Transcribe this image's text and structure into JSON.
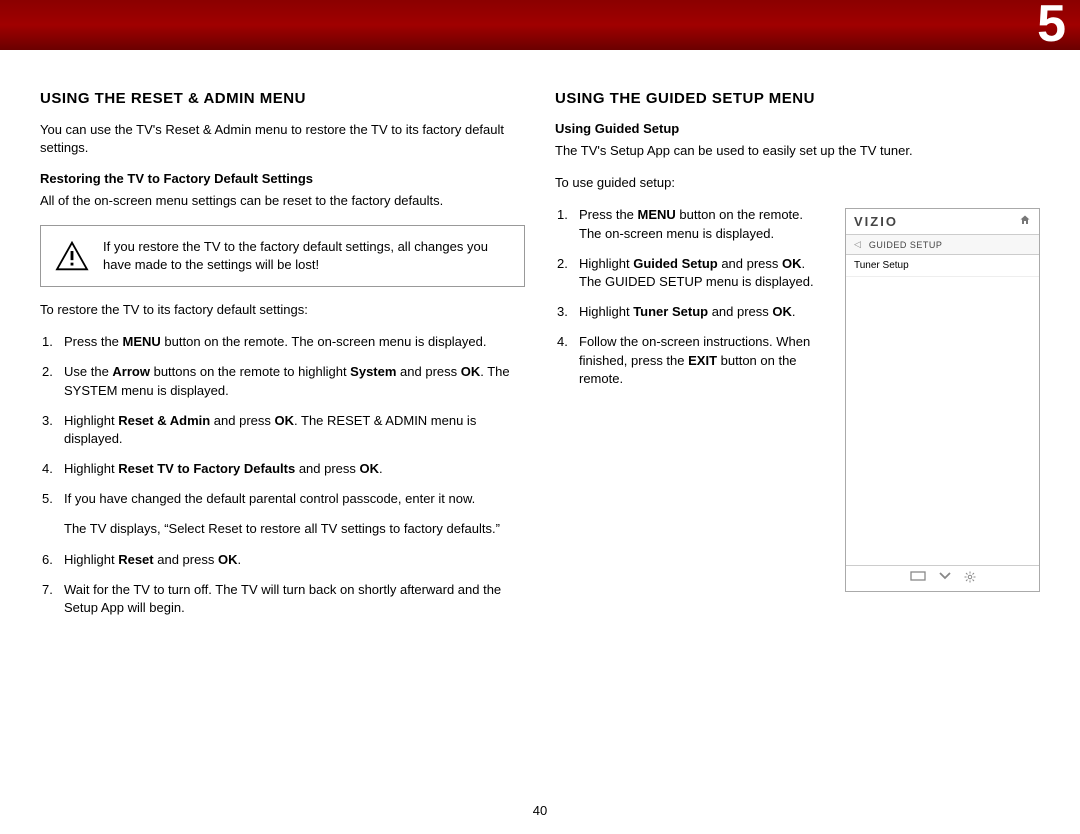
{
  "chapter_number": "5",
  "page_number": "40",
  "left": {
    "heading": "USING THE RESET & ADMIN MENU",
    "intro": "You can use the TV's Reset & Admin menu to restore the TV to its factory default settings.",
    "sub_heading": "Restoring the TV to Factory Default Settings",
    "sub_intro": "All of the on-screen menu settings can be reset to the factory defaults.",
    "warning": "If you restore the TV to the factory default settings, all changes you have made to the settings will be lost!",
    "restore_intro": "To restore the TV to its factory default settings:",
    "steps": {
      "s1_a": "Press the ",
      "s1_b": "MENU",
      "s1_c": " button on the remote. The on-screen menu is displayed.",
      "s2_a": "Use the ",
      "s2_b": "Arrow",
      "s2_c": " buttons on the remote to highlight ",
      "s2_d": "System",
      "s2_e": " and press ",
      "s2_f": "OK",
      "s2_g": ". The SYSTEM menu is displayed.",
      "s3_a": "Highlight ",
      "s3_b": "Reset & Admin",
      "s3_c": " and press ",
      "s3_d": "OK",
      "s3_e": ". The RESET & ADMIN menu is displayed.",
      "s4_a": "Highlight ",
      "s4_b": "Reset TV to Factory Defaults",
      "s4_c": " and press ",
      "s4_d": "OK",
      "s4_e": ".",
      "s5_a": "If you have changed the default parental control passcode, enter it now.",
      "s5_follow": "The TV displays, “Select Reset to restore all TV settings to factory defaults.”",
      "s6_a": "Highlight ",
      "s6_b": "Reset",
      "s6_c": " and press ",
      "s6_d": "OK",
      "s6_e": ".",
      "s7_a": "Wait for the TV to turn off. The TV will turn back on shortly afterward and the Setup App will begin."
    }
  },
  "right": {
    "heading": "USING THE GUIDED SETUP MENU",
    "sub_heading": "Using Guided Setup",
    "intro": "The TV's Setup App can be used to easily set up the TV tuner.",
    "use_intro": "To use guided setup:",
    "steps": {
      "s1_a": "Press the ",
      "s1_b": "MENU",
      "s1_c": " button on the remote. The on-screen menu is displayed.",
      "s2_a": "Highlight ",
      "s2_b": "Guided Setup",
      "s2_c": " and press ",
      "s2_d": "OK",
      "s2_e": ". The GUIDED SETUP menu is displayed.",
      "s3_a": "Highlight ",
      "s3_b": "Tuner Setup",
      "s3_c": " and press ",
      "s3_d": "OK",
      "s3_e": ".",
      "s4_a": "Follow the on-screen instructions. When finished, press the ",
      "s4_b": "EXIT",
      "s4_c": " button on the remote."
    },
    "tv": {
      "brand": "VIZIO",
      "crumb": "GUIDED SETUP",
      "item1": "Tuner Setup"
    }
  }
}
